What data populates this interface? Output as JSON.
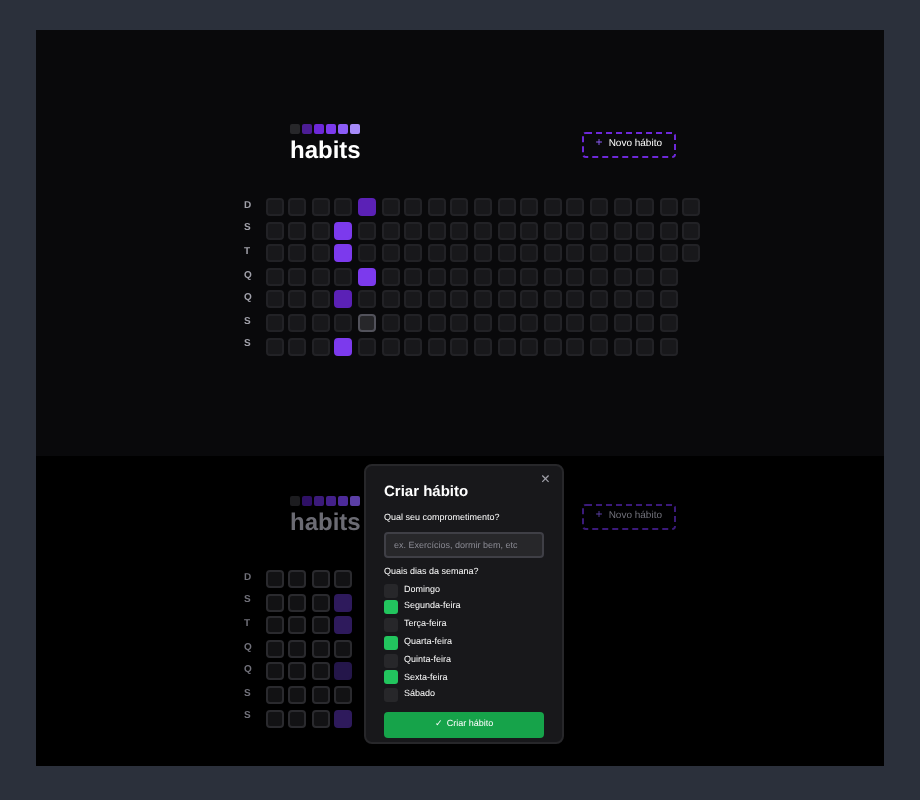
{
  "views": [
    {
      "logo": {
        "squares": [
          {
            "color": "#27272a"
          },
          {
            "color": "#4c1d95"
          },
          {
            "color": "#6d28d9"
          },
          {
            "color": "#7c3aed"
          },
          {
            "color": "#8b5cf6"
          },
          {
            "color": "#a78bfa"
          }
        ]
      },
      "title": "habits",
      "new_button": {
        "icon": "+",
        "label": "Novo hábito"
      },
      "grid": [
        {
          "label": "D",
          "cells": [
            {
              "kind": "empty"
            },
            {
              "kind": "empty"
            },
            {
              "kind": "empty"
            },
            {
              "kind": "empty"
            },
            {
              "kind": "partial"
            },
            {
              "kind": "empty"
            },
            {
              "kind": "empty"
            },
            {
              "kind": "empty"
            },
            {
              "kind": "empty"
            },
            {
              "kind": "empty"
            },
            {
              "kind": "empty"
            },
            {
              "kind": "empty"
            },
            {
              "kind": "empty"
            },
            {
              "kind": "empty"
            },
            {
              "kind": "empty"
            },
            {
              "kind": "empty"
            },
            {
              "kind": "empty"
            },
            {
              "kind": "empty"
            },
            {
              "kind": "empty"
            }
          ]
        },
        {
          "label": "S",
          "cells": [
            {
              "kind": "empty"
            },
            {
              "kind": "empty"
            },
            {
              "kind": "empty"
            },
            {
              "kind": "complete"
            },
            {
              "kind": "empty"
            },
            {
              "kind": "empty"
            },
            {
              "kind": "empty"
            },
            {
              "kind": "empty"
            },
            {
              "kind": "empty"
            },
            {
              "kind": "empty"
            },
            {
              "kind": "empty"
            },
            {
              "kind": "empty"
            },
            {
              "kind": "empty"
            },
            {
              "kind": "empty"
            },
            {
              "kind": "empty"
            },
            {
              "kind": "empty"
            },
            {
              "kind": "empty"
            },
            {
              "kind": "empty"
            },
            {
              "kind": "empty"
            }
          ]
        },
        {
          "label": "T",
          "cells": [
            {
              "kind": "empty"
            },
            {
              "kind": "empty"
            },
            {
              "kind": "empty"
            },
            {
              "kind": "complete"
            },
            {
              "kind": "empty"
            },
            {
              "kind": "empty"
            },
            {
              "kind": "empty"
            },
            {
              "kind": "empty"
            },
            {
              "kind": "empty"
            },
            {
              "kind": "empty"
            },
            {
              "kind": "empty"
            },
            {
              "kind": "empty"
            },
            {
              "kind": "empty"
            },
            {
              "kind": "empty"
            },
            {
              "kind": "empty"
            },
            {
              "kind": "empty"
            },
            {
              "kind": "empty"
            },
            {
              "kind": "empty"
            },
            {
              "kind": "empty"
            }
          ]
        },
        {
          "label": "Q",
          "cells": [
            {
              "kind": "empty"
            },
            {
              "kind": "empty"
            },
            {
              "kind": "empty"
            },
            {
              "kind": "empty"
            },
            {
              "kind": "complete"
            },
            {
              "kind": "empty"
            },
            {
              "kind": "empty"
            },
            {
              "kind": "empty"
            },
            {
              "kind": "empty"
            },
            {
              "kind": "empty"
            },
            {
              "kind": "empty"
            },
            {
              "kind": "empty"
            },
            {
              "kind": "empty"
            },
            {
              "kind": "empty"
            },
            {
              "kind": "empty"
            },
            {
              "kind": "empty"
            },
            {
              "kind": "empty"
            },
            {
              "kind": "empty"
            }
          ]
        },
        {
          "label": "Q",
          "cells": [
            {
              "kind": "empty"
            },
            {
              "kind": "empty"
            },
            {
              "kind": "empty"
            },
            {
              "kind": "partial"
            },
            {
              "kind": "empty"
            },
            {
              "kind": "empty"
            },
            {
              "kind": "empty"
            },
            {
              "kind": "empty"
            },
            {
              "kind": "empty"
            },
            {
              "kind": "empty"
            },
            {
              "kind": "empty"
            },
            {
              "kind": "empty"
            },
            {
              "kind": "empty"
            },
            {
              "kind": "empty"
            },
            {
              "kind": "empty"
            },
            {
              "kind": "empty"
            },
            {
              "kind": "empty"
            },
            {
              "kind": "empty"
            }
          ]
        },
        {
          "label": "S",
          "cells": [
            {
              "kind": "empty"
            },
            {
              "kind": "empty"
            },
            {
              "kind": "empty"
            },
            {
              "kind": "empty"
            },
            {
              "kind": "today"
            },
            {
              "kind": "empty"
            },
            {
              "kind": "empty"
            },
            {
              "kind": "empty"
            },
            {
              "kind": "empty"
            },
            {
              "kind": "empty"
            },
            {
              "kind": "empty"
            },
            {
              "kind": "empty"
            },
            {
              "kind": "empty"
            },
            {
              "kind": "empty"
            },
            {
              "kind": "empty"
            },
            {
              "kind": "empty"
            },
            {
              "kind": "empty"
            },
            {
              "kind": "empty"
            }
          ]
        },
        {
          "label": "S",
          "cells": [
            {
              "kind": "empty"
            },
            {
              "kind": "empty"
            },
            {
              "kind": "empty"
            },
            {
              "kind": "complete"
            },
            {
              "kind": "empty"
            },
            {
              "kind": "empty"
            },
            {
              "kind": "empty"
            },
            {
              "kind": "empty"
            },
            {
              "kind": "empty"
            },
            {
              "kind": "empty"
            },
            {
              "kind": "empty"
            },
            {
              "kind": "empty"
            },
            {
              "kind": "empty"
            },
            {
              "kind": "empty"
            },
            {
              "kind": "empty"
            },
            {
              "kind": "empty"
            },
            {
              "kind": "empty"
            },
            {
              "kind": "empty"
            }
          ]
        }
      ]
    },
    {
      "logo": {
        "squares": [
          {
            "color": "#1c1c1f"
          },
          {
            "color": "#2e1065"
          },
          {
            "color": "#3b1a7a"
          },
          {
            "color": "#43208a"
          },
          {
            "color": "#4c2a99"
          },
          {
            "color": "#5b3fa6"
          }
        ]
      },
      "title": "habits",
      "new_button": {
        "icon": "+",
        "label": "Novo hábito"
      },
      "grid": [
        {
          "label": "D",
          "cells": [
            {
              "kind": "empty"
            },
            {
              "kind": "empty"
            },
            {
              "kind": "empty"
            },
            {
              "kind": "empty"
            }
          ]
        },
        {
          "label": "S",
          "cells": [
            {
              "kind": "empty"
            },
            {
              "kind": "empty"
            },
            {
              "kind": "empty"
            },
            {
              "kind": "complete"
            }
          ]
        },
        {
          "label": "T",
          "cells": [
            {
              "kind": "empty"
            },
            {
              "kind": "empty"
            },
            {
              "kind": "empty"
            },
            {
              "kind": "complete"
            }
          ]
        },
        {
          "label": "Q",
          "cells": [
            {
              "kind": "empty"
            },
            {
              "kind": "empty"
            },
            {
              "kind": "empty"
            },
            {
              "kind": "empty"
            }
          ]
        },
        {
          "label": "Q",
          "cells": [
            {
              "kind": "empty"
            },
            {
              "kind": "empty"
            },
            {
              "kind": "empty"
            },
            {
              "kind": "partial"
            }
          ]
        },
        {
          "label": "S",
          "cells": [
            {
              "kind": "empty"
            },
            {
              "kind": "empty"
            },
            {
              "kind": "empty"
            },
            {
              "kind": "empty"
            }
          ]
        },
        {
          "label": "S",
          "cells": [
            {
              "kind": "empty"
            },
            {
              "kind": "empty"
            },
            {
              "kind": "empty"
            },
            {
              "kind": "complete"
            }
          ]
        }
      ],
      "modal": {
        "title": "Criar hábito",
        "close": "×",
        "question": "Qual seu comprometimento?",
        "placeholder": "ex. Exercícios, dormir bem, etc",
        "days_question": "Quais dias da semana?",
        "days": [
          {
            "label": "Domingo",
            "checked": false
          },
          {
            "label": "Segunda-feira",
            "checked": true
          },
          {
            "label": "Terça-feira",
            "checked": false
          },
          {
            "label": "Quarta-feira",
            "checked": true
          },
          {
            "label": "Quinta-feira",
            "checked": false
          },
          {
            "label": "Sexta-feira",
            "checked": true
          },
          {
            "label": "Sábado",
            "checked": false
          }
        ],
        "submit": {
          "icon": "✓",
          "label": "Criar hábito"
        }
      }
    }
  ]
}
